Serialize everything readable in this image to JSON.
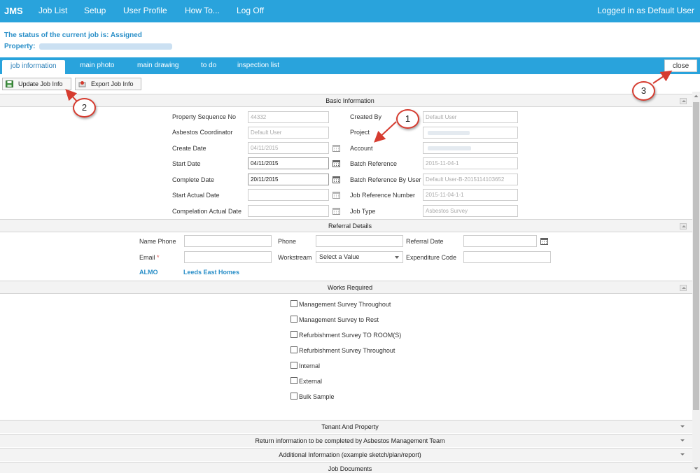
{
  "navbar": {
    "brand": "JMS",
    "items": [
      "Job List",
      "Setup",
      "User Profile",
      "How To...",
      "Log Off"
    ],
    "logged_in": "Logged in as Default User"
  },
  "status": {
    "text": "The status of the current job is: Assigned",
    "property_label": "Property:"
  },
  "tabs": [
    "job information",
    "main photo",
    "main drawing",
    "to do",
    "inspection list"
  ],
  "close_label": "close",
  "toolbar": {
    "update": "Update Job Info",
    "export": "Export Job Info"
  },
  "sections": {
    "basic": "Basic Information",
    "referral": "Referral Details",
    "works": "Works Required",
    "tenant": "Tenant And Property",
    "return_info": "Return information to be completed by Asbestos Management Team",
    "additional": "Additional Information (example sketch/plan/report)",
    "documents": "Job Documents"
  },
  "basic": {
    "property_sequence_label": "Property Sequence No",
    "property_sequence_value": "44332",
    "asbestos_coordinator_label": "Asbestos Coordinator",
    "asbestos_coordinator_value": "Default User",
    "create_date_label": "Create Date",
    "create_date_value": "04/11/2015",
    "start_date_label": "Start Date",
    "start_date_value": "04/11/2015",
    "complete_date_label": "Complete Date",
    "complete_date_value": "20/11/2015",
    "start_actual_label": "Start Actual Date",
    "start_actual_value": "",
    "compelation_actual_label": "Compelation Actual Date",
    "compelation_actual_value": "",
    "created_by_label": "Created By",
    "created_by_value": "Default User",
    "project_label": "Project",
    "project_value": "",
    "account_label": "Account",
    "account_value": "",
    "batch_ref_label": "Batch Reference",
    "batch_ref_value": "2015-11-04-1",
    "batch_ref_user_label": "Batch Reference By User",
    "batch_ref_user_value": "Default User-B-2015114103652",
    "job_ref_label": "Job Reference Number",
    "job_ref_value": "2015-11-04-1-1",
    "job_type_label": "Job Type",
    "job_type_value": "Asbestos Survey"
  },
  "referral": {
    "name_phone_label": "Name Phone",
    "phone_label": "Phone",
    "referral_date_label": "Referral Date",
    "email_label": "Email",
    "required_mark": "*",
    "workstream_label": "Workstream",
    "workstream_value": "Select a Value",
    "expenditure_label": "Expenditure Code",
    "almo_label": "ALMO",
    "almo_value": "Leeds East Homes"
  },
  "works": [
    "Management Survey Throughout",
    "Management Survey to Rest",
    "Refurbishment Survey TO ROOM(S)",
    "Refurbishment Survey Throughout",
    "Internal",
    "External",
    "Bulk Sample"
  ],
  "callouts": [
    "1",
    "2",
    "3"
  ],
  "colors": {
    "accent": "#29a3dc",
    "link": "#2a8fc8",
    "callout_border": "#d63c30"
  }
}
